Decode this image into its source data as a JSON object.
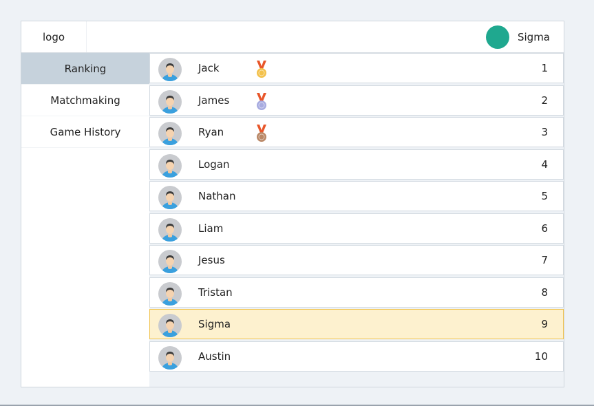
{
  "header": {
    "logo_text": "logo",
    "user": {
      "name": "Sigma",
      "avatar_color": "#1fa88f"
    }
  },
  "sidebar": {
    "items": [
      {
        "label": "Ranking",
        "active": true
      },
      {
        "label": "Matchmaking",
        "active": false
      },
      {
        "label": "Game History",
        "active": false
      }
    ]
  },
  "ranking": {
    "rows": [
      {
        "name": "Jack",
        "rank": "1",
        "medal": "gold"
      },
      {
        "name": "James",
        "rank": "2",
        "medal": "silver"
      },
      {
        "name": "Ryan",
        "rank": "3",
        "medal": "bronze"
      },
      {
        "name": "Logan",
        "rank": "4",
        "medal": null
      },
      {
        "name": "Nathan",
        "rank": "5",
        "medal": null
      },
      {
        "name": "Liam",
        "rank": "6",
        "medal": null
      },
      {
        "name": "Jesus",
        "rank": "7",
        "medal": null
      },
      {
        "name": "Tristan",
        "rank": "8",
        "medal": null
      },
      {
        "name": "Sigma",
        "rank": "9",
        "medal": null,
        "highlight": true
      },
      {
        "name": "Austin",
        "rank": "10",
        "medal": null
      }
    ]
  },
  "colors": {
    "accent": "#1fa88f",
    "active_nav": "#c6d2dc",
    "highlight_bg": "#fdf1cf",
    "highlight_border": "#f1c24a",
    "medal_ribbon": "#e8562a",
    "gold": "#f3c14b",
    "silver": "#a7abe0",
    "bronze": "#b98766"
  }
}
